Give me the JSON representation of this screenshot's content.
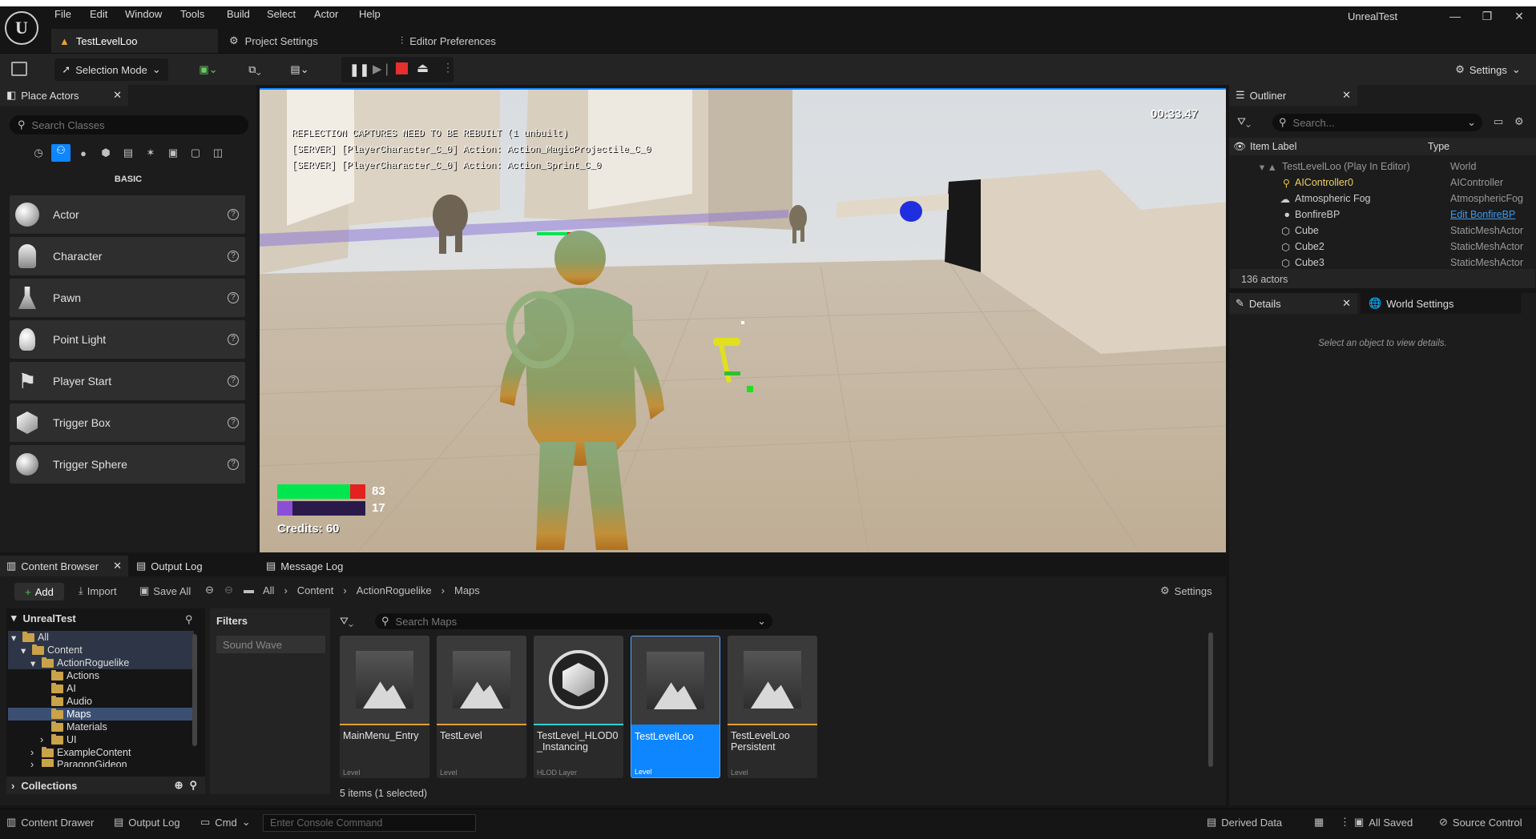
{
  "app": {
    "project_name": "UnrealTest",
    "menu": [
      "File",
      "Edit",
      "Window",
      "Tools",
      "Build",
      "Select",
      "Actor",
      "Help"
    ],
    "tabs": [
      {
        "label": "TestLevelLoo"
      },
      {
        "label": "Project Settings"
      },
      {
        "label": "Editor Preferences"
      }
    ]
  },
  "toolbar": {
    "mode_label": "Selection Mode",
    "settings_label": "Settings"
  },
  "place_actors": {
    "title": "Place Actors",
    "search_placeholder": "Search Classes",
    "category": "BASIC",
    "items": [
      {
        "label": "Actor"
      },
      {
        "label": "Character"
      },
      {
        "label": "Pawn"
      },
      {
        "label": "Point Light"
      },
      {
        "label": "Player Start"
      },
      {
        "label": "Trigger Box"
      },
      {
        "label": "Trigger Sphere"
      }
    ]
  },
  "viewport": {
    "timer": "00:33.47",
    "messages": [
      "REFLECTION CAPTURES NEED TO BE REBUILT (1 unbuilt)",
      "[SERVER] [PlayerCharacter_C_0] Action: Action_MagicProjectile_C_0",
      "[SERVER] [PlayerCharacter_C_0] Action: Action_Sprint_C_0"
    ],
    "health_value": "83",
    "health_fraction": 0.83,
    "rage_value": "17",
    "rage_fraction": 0.17,
    "credits": "Credits: 60"
  },
  "outliner": {
    "title": "Outliner",
    "search_placeholder": "Search...",
    "col_label": "Item Label",
    "col_type": "Type",
    "rows": [
      {
        "label": "TestLevelLoo (Play In Editor)",
        "type": "World"
      },
      {
        "label": "AIController0",
        "type": "AIController"
      },
      {
        "label": "Atmospheric Fog",
        "type": "AtmosphericFog"
      },
      {
        "label": "BonfireBP",
        "type": "Edit BonfireBP"
      },
      {
        "label": "Cube",
        "type": "StaticMeshActor"
      },
      {
        "label": "Cube2",
        "type": "StaticMeshActor"
      },
      {
        "label": "Cube3",
        "type": "StaticMeshActor"
      }
    ],
    "count": "136 actors"
  },
  "details": {
    "tab1": "Details",
    "tab2": "World Settings",
    "empty": "Select an object to view details."
  },
  "bottom_tabs": {
    "content_browser": "Content Browser",
    "output_log": "Output Log",
    "message_log": "Message Log"
  },
  "content_browser": {
    "add": "Add",
    "import": "Import",
    "save_all": "Save All",
    "breadcrumb": [
      "All",
      "Content",
      "ActionRoguelike",
      "Maps"
    ],
    "settings": "Settings",
    "tree_root": "UnrealTest",
    "tree": [
      {
        "label": "All",
        "indent": 0
      },
      {
        "label": "Content",
        "indent": 1
      },
      {
        "label": "ActionRoguelike",
        "indent": 2
      },
      {
        "label": "Actions",
        "indent": 3
      },
      {
        "label": "AI",
        "indent": 3
      },
      {
        "label": "Audio",
        "indent": 3
      },
      {
        "label": "Maps",
        "indent": 3
      },
      {
        "label": "Materials",
        "indent": 3
      },
      {
        "label": "UI",
        "indent": 3
      },
      {
        "label": "ExampleContent",
        "indent": 2
      },
      {
        "label": "ParagonGideon",
        "indent": 2
      }
    ],
    "collections": "Collections",
    "filters": "Filters",
    "filter_chip": "Sound Wave",
    "search_placeholder": "Search Maps",
    "assets": [
      {
        "name": "MainMenu_Entry",
        "kind": "Level"
      },
      {
        "name": "TestLevel",
        "kind": "Level"
      },
      {
        "name": "TestLevel_HLOD0_Instancing",
        "kind": "HLOD Layer"
      },
      {
        "name": "TestLevelLoo",
        "kind": "Level"
      },
      {
        "name": "TestLevelLoo Persistent",
        "kind": "Level"
      }
    ],
    "status": "5 items (1 selected)"
  },
  "statusbar": {
    "content_drawer": "Content Drawer",
    "output_log": "Output Log",
    "cmd": "Cmd",
    "console_placeholder": "Enter Console Command",
    "derived_data": "Derived Data",
    "all_saved": "All Saved",
    "source_control": "Source Control"
  },
  "colors": {
    "accent": "#0e86ff",
    "health": "#00e64d",
    "rage": "#8a4fd6",
    "level_bar": "#e0a030",
    "hlod_bar": "#2fd0d0"
  }
}
